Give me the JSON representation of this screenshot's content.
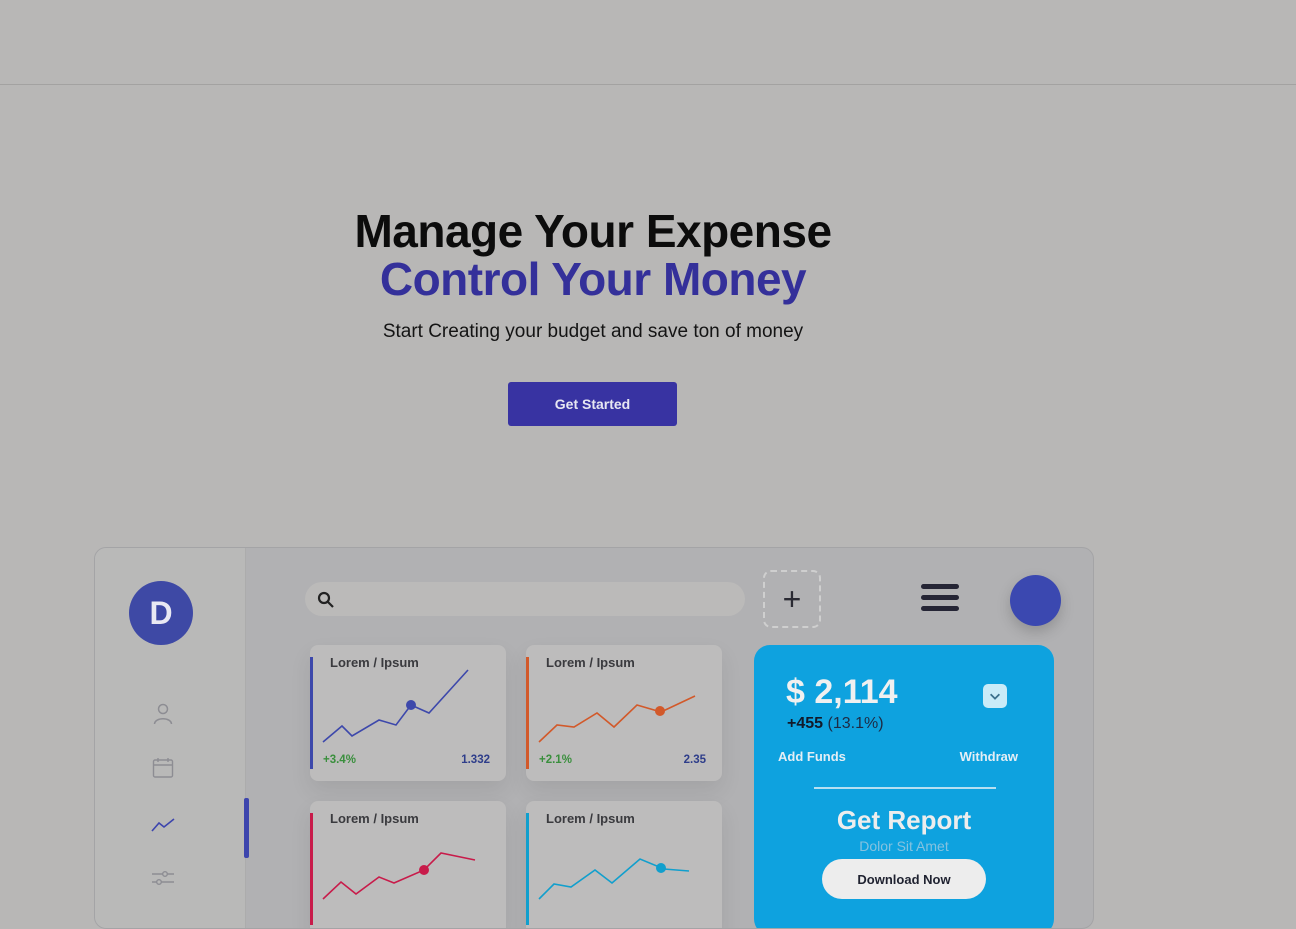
{
  "hero": {
    "title_line1": "Manage Your Expense",
    "title_line2": "Control Your Money",
    "subtitle": "Start Creating your budget and save ton of money",
    "cta_label": "Get Started"
  },
  "dashboard": {
    "logo_letter": "D",
    "search_placeholder": "",
    "plus_label": "+",
    "sidebar_icons": [
      "user-icon",
      "calendar-icon",
      "chart-line-icon",
      "sliders-icon"
    ],
    "cards": [
      {
        "label": "Lorem / Ipsum",
        "change": "+3.4%",
        "value": "1.332",
        "color": "#3d48ab"
      },
      {
        "label": "Lorem / Ipsum",
        "change": "+2.1%",
        "value": "2.35",
        "color": "#d2592a"
      },
      {
        "label": "Lorem / Ipsum",
        "change": "",
        "value": "",
        "color": "#c81b4a"
      },
      {
        "label": "Lorem / Ipsum",
        "change": "",
        "value": "",
        "color": "#119fcd"
      }
    ],
    "promo": {
      "balance": "$ 2,114",
      "change_amount": "+455",
      "change_pct": " (13.1%)",
      "add_funds": "Add Funds",
      "withdraw": "Withdraw",
      "report_title": "Get Report",
      "report_subtitle": "Dolor Sit Amet",
      "download_label": "Download Now"
    }
  },
  "colors": {
    "accent": "#3833a2",
    "promo": "#0ea2df",
    "title_accent": "#34309a"
  }
}
